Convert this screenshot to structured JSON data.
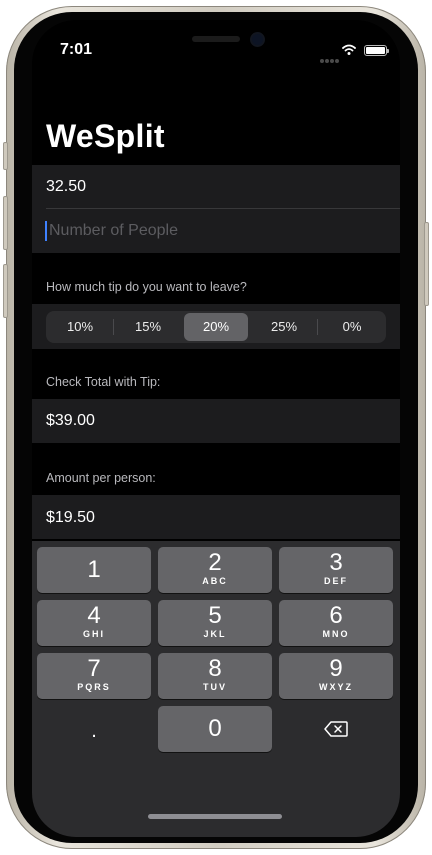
{
  "status_bar": {
    "time": "7:01"
  },
  "app": {
    "title": "WeSplit"
  },
  "form": {
    "amount_value": "32.50",
    "people_placeholder": "Number of People"
  },
  "tip": {
    "header": "How much tip do you want to leave?",
    "options": [
      "10%",
      "15%",
      "20%",
      "25%",
      "0%"
    ],
    "selected": "20%"
  },
  "total": {
    "header": "Check Total with Tip:",
    "value": "$39.00"
  },
  "per_person": {
    "header": "Amount per person:",
    "value": "$19.50"
  },
  "keyboard": {
    "keys": [
      {
        "number": "1",
        "letters": ""
      },
      {
        "number": "2",
        "letters": "ABC"
      },
      {
        "number": "3",
        "letters": "DEF"
      },
      {
        "number": "4",
        "letters": "GHI"
      },
      {
        "number": "5",
        "letters": "JKL"
      },
      {
        "number": "6",
        "letters": "MNO"
      },
      {
        "number": "7",
        "letters": "PQRS"
      },
      {
        "number": "8",
        "letters": "TUV"
      },
      {
        "number": "9",
        "letters": "WXYZ"
      }
    ],
    "decimal": ".",
    "zero": "0"
  },
  "icons": {
    "wifi": "wifi-icon",
    "battery": "battery-icon",
    "delete": "delete-backspace-icon"
  },
  "colors": {
    "background": "#000000",
    "section": "#1c1c1e",
    "segment_selected": "#636366",
    "key": "#656568",
    "cursor": "#3f82ff"
  }
}
